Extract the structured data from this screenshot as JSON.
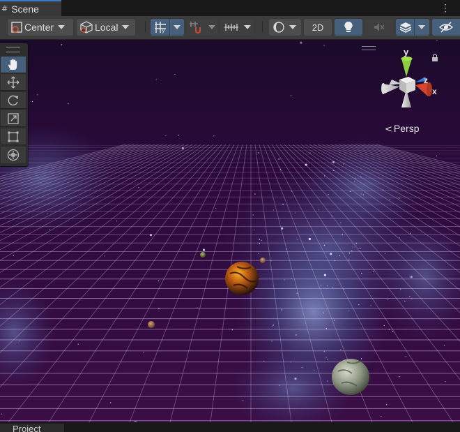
{
  "window": {
    "tab_title": "Scene",
    "tab_icon": "hash-icon",
    "bottom_tab_title": "Project"
  },
  "toolbar": {
    "pivot_label": "Center",
    "space_label": "Local",
    "mode_2d_label": "2D"
  },
  "tools": [
    "hand-tool",
    "move-tool",
    "rotate-tool",
    "scale-tool",
    "rect-tool",
    "transform-tool"
  ],
  "active_tool": "hand-tool",
  "gizmo": {
    "x_label": "x",
    "y_label": "y",
    "z_label": "z",
    "projection_label": "Persp"
  },
  "colors": {
    "accent": "#46607c",
    "axis_x": "#d6452d",
    "axis_y": "#8ccf3a",
    "axis_z": "#3c78d8",
    "sky": "#2a0a3a"
  }
}
